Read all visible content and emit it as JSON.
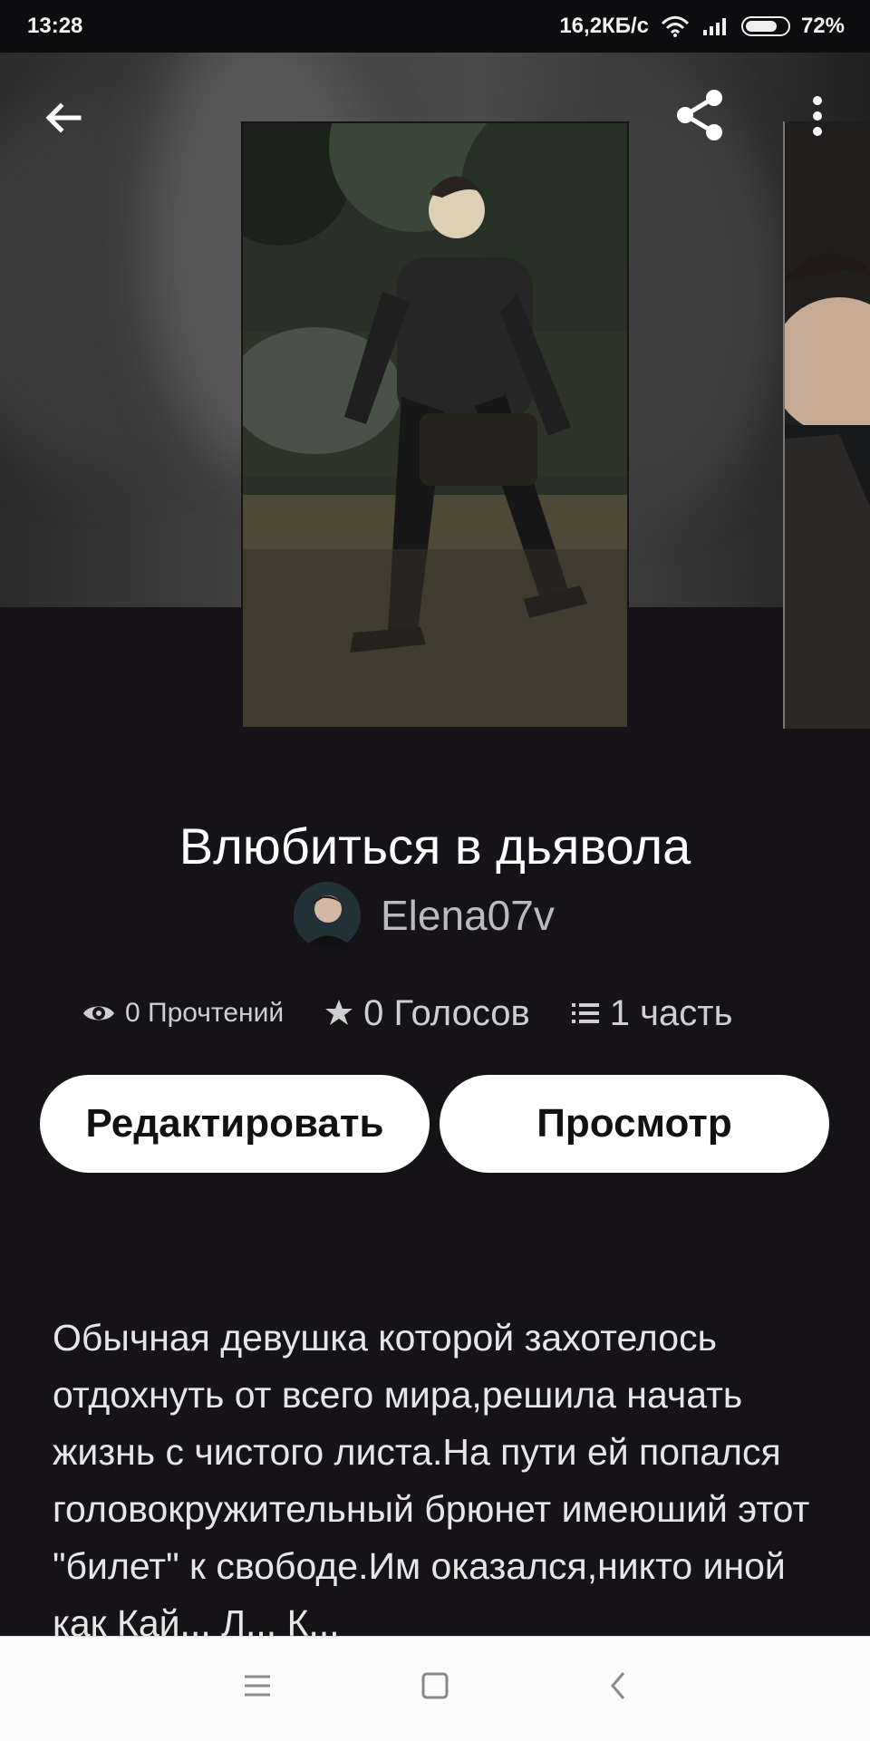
{
  "status_bar": {
    "time": "13:28",
    "network_speed": "16,2КБ/с",
    "battery_percent": "72%",
    "icons": [
      "wifi-icon",
      "signal-icon",
      "battery-icon"
    ]
  },
  "header": {
    "actions": [
      "back-arrow-icon",
      "share-icon",
      "more-vertical-icon"
    ]
  },
  "story": {
    "title": "Влюбиться в дьявола",
    "author": "Elena07v",
    "stats": {
      "reads": "0 Прочтений",
      "votes": "0 Голосов",
      "parts": "1 часть"
    },
    "buttons": {
      "edit": "Редактировать",
      "view": "Просмотр"
    },
    "description": "Обычная девушка которой захотелось отдохнуть от всего мира,решила начать жизнь с чистого листа.На пути ей попался головокружительный брюнет имеюший этот \"билет\" к свободе.Им оказался,никто иной как Кай... Л...  К..."
  },
  "navigation_bar": {
    "icons": [
      "recent-apps-icon",
      "home-icon",
      "back-icon"
    ]
  },
  "colors": {
    "background": "#151317",
    "button_background": "#ffffff",
    "nav_bar": "#fbfbfb"
  }
}
